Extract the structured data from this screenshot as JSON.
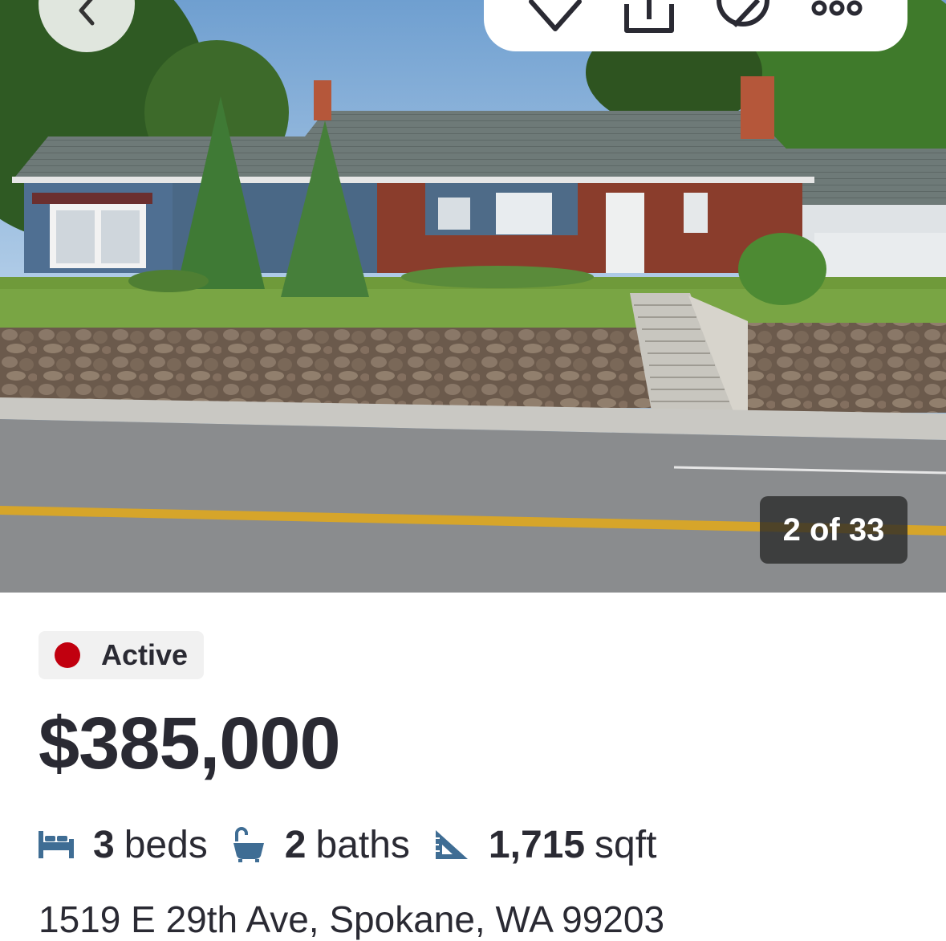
{
  "photo": {
    "counter_text": "2 of 33"
  },
  "toolbar": {
    "back_icon": "chevron-left-icon",
    "favorite_icon": "heart-icon",
    "share_icon": "share-icon",
    "hide_icon": "hide-icon",
    "more_icon": "more-icon"
  },
  "listing": {
    "status": "Active",
    "status_color": "#c1000f",
    "price": "$385,000",
    "beds_value": "3",
    "beds_unit": "beds",
    "baths_value": "2",
    "baths_unit": "baths",
    "sqft_value": "1,715",
    "sqft_unit": "sqft",
    "address": "1519 E 29th Ave, Spokane, WA 99203"
  },
  "colors": {
    "text_primary": "#2a2a33",
    "icon_blue": "#3f6d94",
    "badge_bg": "#f1f1f1"
  }
}
